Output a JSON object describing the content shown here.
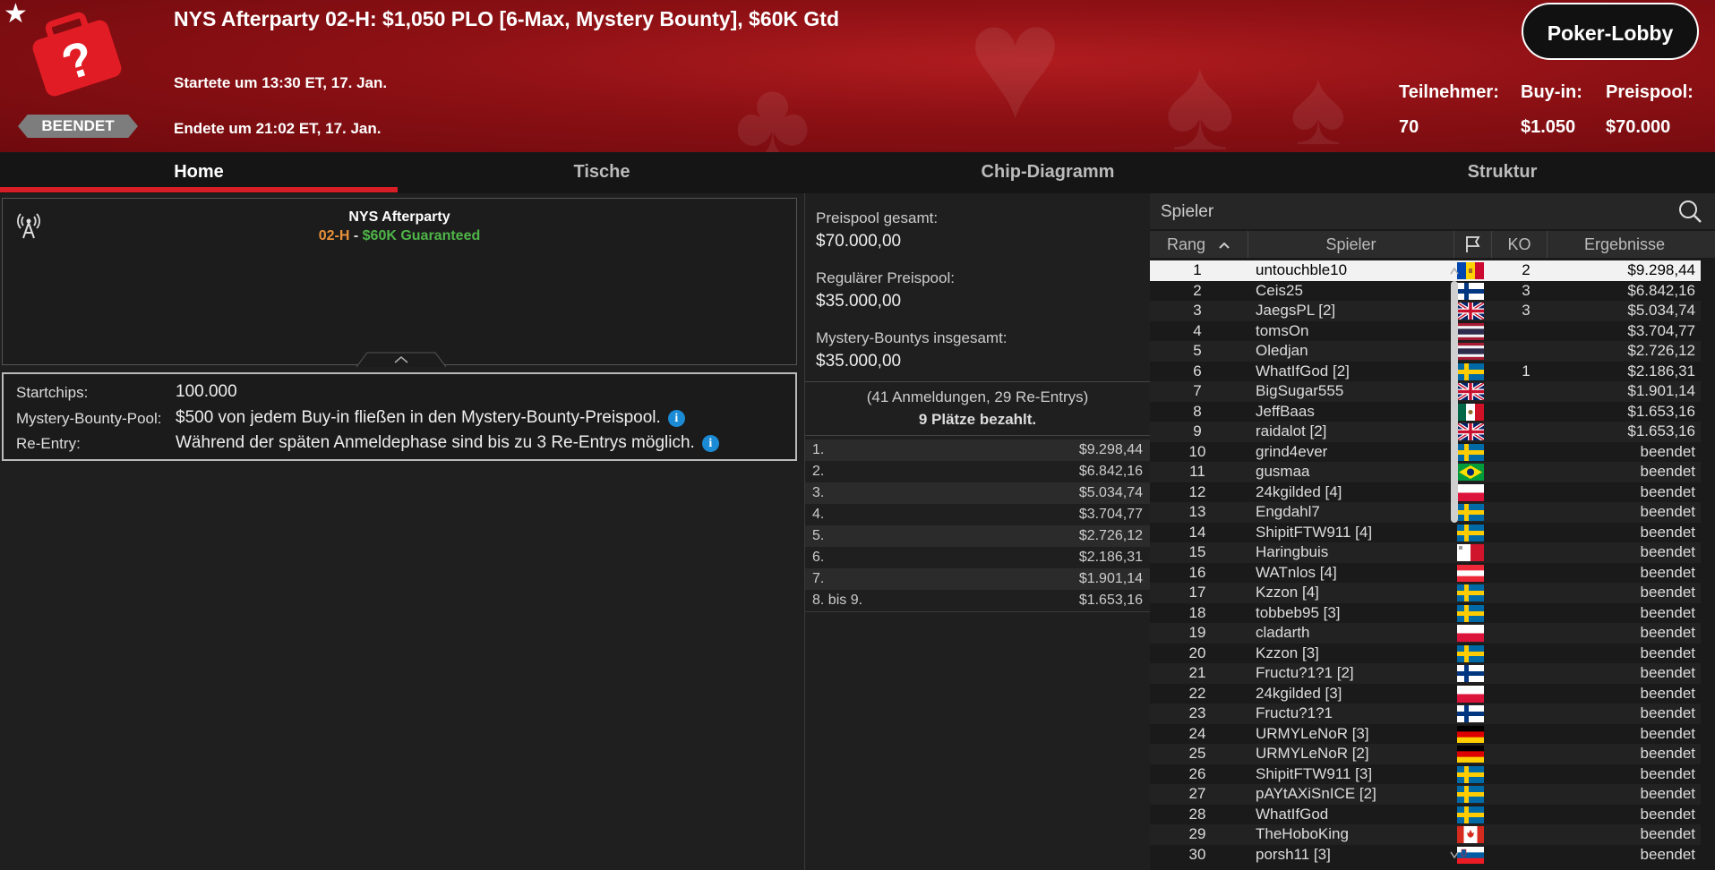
{
  "header": {
    "title": "NYS Afterparty 02-H: $1,050 PLO [6-Max, Mystery Bounty], $60K Gtd",
    "status_badge": "BEENDET",
    "started": "Startete um 13:30 ET, 17. Jan.",
    "ended": "Endete um 21:02 ET, 17. Jan.",
    "lobby_button": "Poker-Lobby",
    "stats": [
      {
        "label": "Teilnehmer:",
        "value": "70"
      },
      {
        "label": "Buy-in:",
        "value": "$1.050"
      },
      {
        "label": "Preispool:",
        "value": "$70.000"
      }
    ]
  },
  "tabs": [
    "Home",
    "Tische",
    "Chip-Diagramm",
    "Struktur"
  ],
  "info": {
    "name": "NYS Afterparty",
    "sub_code": "02-H",
    "sub_sep": " - ",
    "sub_guarantee": "$60K Guaranteed"
  },
  "details": [
    {
      "label": "Startchips:",
      "value": "100.000",
      "info": false
    },
    {
      "label": "Mystery-Bounty-Pool:",
      "value": "$500 von jedem Buy-in fließen in den Mystery-Bounty-Preispool.",
      "info": true
    },
    {
      "label": "Re-Entry:",
      "value": "Während der späten Anmeldephase sind bis zu 3 Re-Entrys möglich.",
      "info": true
    }
  ],
  "prizepool": {
    "total_label": "Preispool gesamt:",
    "total_value": "$70.000,00",
    "regular_label": "Regulärer Preispool:",
    "regular_value": "$35.000,00",
    "bounty_label": "Mystery-Bountys insgesamt:",
    "bounty_value": "$35.000,00",
    "entries": "(41 Anmeldungen, 29 Re-Entrys)",
    "paid": "9 Plätze bezahlt."
  },
  "payouts": [
    {
      "place": "1.",
      "amount": "$9.298,44"
    },
    {
      "place": "2.",
      "amount": "$6.842,16"
    },
    {
      "place": "3.",
      "amount": "$5.034,74"
    },
    {
      "place": "4.",
      "amount": "$3.704,77"
    },
    {
      "place": "5.",
      "amount": "$2.726,12"
    },
    {
      "place": "6.",
      "amount": "$2.186,31"
    },
    {
      "place": "7.",
      "amount": "$1.901,14"
    },
    {
      "place": "8. bis 9.",
      "amount": "$1.653,16"
    }
  ],
  "players": {
    "search_label": "Spieler",
    "columns": {
      "rank": "Rang",
      "player": "Spieler",
      "ko": "KO",
      "result": "Ergebnisse"
    },
    "rows": [
      {
        "rank": "1",
        "name": "untouchble10",
        "flag": "md",
        "ko": "2",
        "result": "$9.298,44"
      },
      {
        "rank": "2",
        "name": "Ceis25",
        "flag": "fi",
        "ko": "3",
        "result": "$6.842,16"
      },
      {
        "rank": "3",
        "name": "JaegsPL [2]",
        "flag": "gb",
        "ko": "3",
        "result": "$5.034,74"
      },
      {
        "rank": "4",
        "name": "tomsOn",
        "flag": "th",
        "ko": "",
        "result": "$3.704,77"
      },
      {
        "rank": "5",
        "name": "Oledjan",
        "flag": "th",
        "ko": "",
        "result": "$2.726,12"
      },
      {
        "rank": "6",
        "name": "WhatIfGod [2]",
        "flag": "se",
        "ko": "1",
        "result": "$2.186,31"
      },
      {
        "rank": "7",
        "name": "BigSugar555",
        "flag": "gb",
        "ko": "",
        "result": "$1.901,14"
      },
      {
        "rank": "8",
        "name": "JeffBaas",
        "flag": "mx",
        "ko": "",
        "result": "$1.653,16"
      },
      {
        "rank": "9",
        "name": "raidalot [2]",
        "flag": "gb",
        "ko": "",
        "result": "$1.653,16"
      },
      {
        "rank": "10",
        "name": "grind4ever",
        "flag": "se",
        "ko": "",
        "result": "beendet"
      },
      {
        "rank": "11",
        "name": "gusmaa",
        "flag": "br",
        "ko": "",
        "result": "beendet"
      },
      {
        "rank": "12",
        "name": "24kgilded [4]",
        "flag": "pl",
        "ko": "",
        "result": "beendet"
      },
      {
        "rank": "13",
        "name": "Engdahl7",
        "flag": "se",
        "ko": "",
        "result": "beendet"
      },
      {
        "rank": "14",
        "name": "ShipitFTW911 [4]",
        "flag": "se",
        "ko": "",
        "result": "beendet"
      },
      {
        "rank": "15",
        "name": "Haringbuis",
        "flag": "mt",
        "ko": "",
        "result": "beendet"
      },
      {
        "rank": "16",
        "name": "WATnlos [4]",
        "flag": "at",
        "ko": "",
        "result": "beendet"
      },
      {
        "rank": "17",
        "name": "Kzzon [4]",
        "flag": "se",
        "ko": "",
        "result": "beendet"
      },
      {
        "rank": "18",
        "name": "tobbeb95 [3]",
        "flag": "se",
        "ko": "",
        "result": "beendet"
      },
      {
        "rank": "19",
        "name": "cladarth",
        "flag": "pl",
        "ko": "",
        "result": "beendet"
      },
      {
        "rank": "20",
        "name": "Kzzon [3]",
        "flag": "se",
        "ko": "",
        "result": "beendet"
      },
      {
        "rank": "21",
        "name": "Fructu?1?1 [2]",
        "flag": "fi",
        "ko": "",
        "result": "beendet"
      },
      {
        "rank": "22",
        "name": "24kgilded [3]",
        "flag": "pl",
        "ko": "",
        "result": "beendet"
      },
      {
        "rank": "23",
        "name": "Fructu?1?1",
        "flag": "fi",
        "ko": "",
        "result": "beendet"
      },
      {
        "rank": "24",
        "name": "URMYLeNoR [3]",
        "flag": "de",
        "ko": "",
        "result": "beendet"
      },
      {
        "rank": "25",
        "name": "URMYLeNoR [2]",
        "flag": "de",
        "ko": "",
        "result": "beendet"
      },
      {
        "rank": "26",
        "name": "ShipitFTW911 [3]",
        "flag": "se",
        "ko": "",
        "result": "beendet"
      },
      {
        "rank": "27",
        "name": "pAYtAXiSnICE [2]",
        "flag": "se",
        "ko": "",
        "result": "beendet"
      },
      {
        "rank": "28",
        "name": "WhatIfGod",
        "flag": "se",
        "ko": "",
        "result": "beendet"
      },
      {
        "rank": "29",
        "name": "TheHoboKing",
        "flag": "ca",
        "ko": "",
        "result": "beendet"
      },
      {
        "rank": "30",
        "name": "porsh11 [3]",
        "flag": "si",
        "ko": "",
        "result": "beendet"
      }
    ]
  },
  "colors": {
    "accent": "#d81e26",
    "header_red": "#8c1014",
    "guarantee_green": "#4eb548",
    "code_orange": "#e8913a",
    "info_blue": "#1c8bd6"
  }
}
